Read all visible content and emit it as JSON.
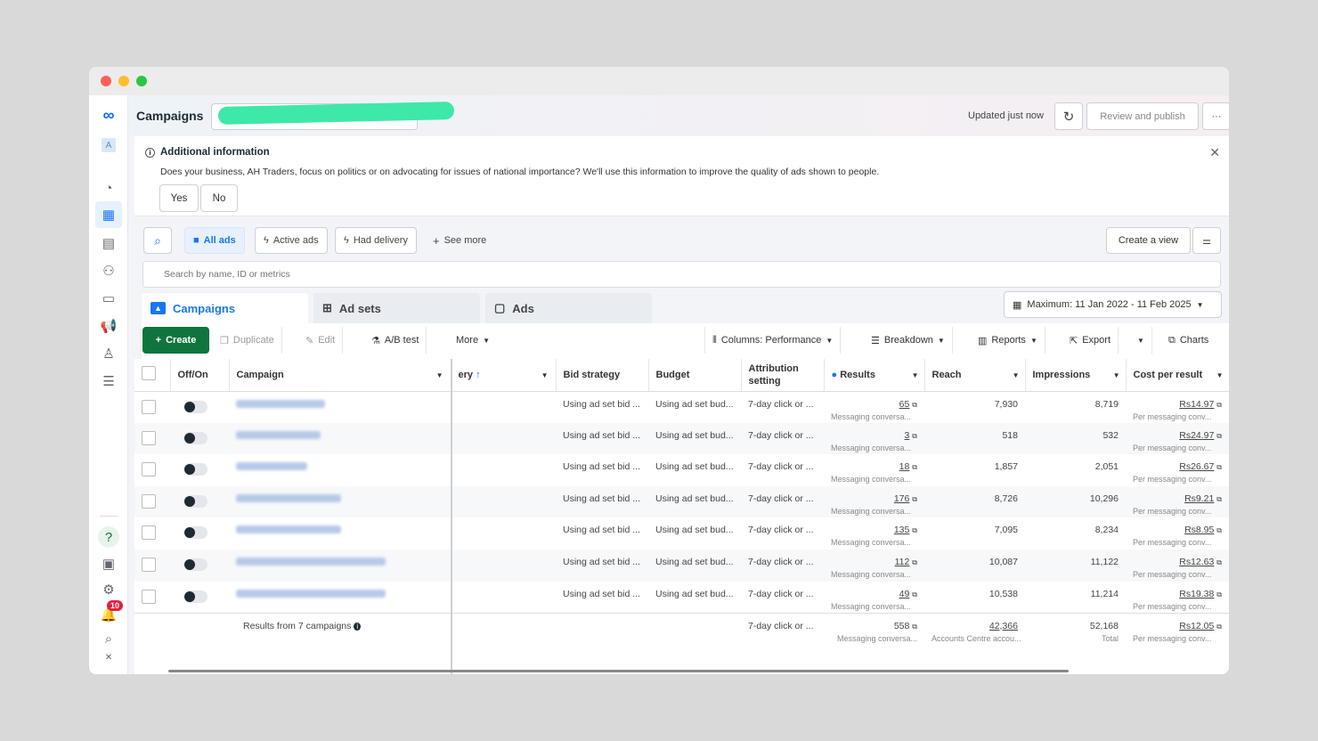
{
  "window": {
    "title": ""
  },
  "topbar": {
    "title": "Campaigns",
    "updated": "Updated just now",
    "review_publish": "Review and publish",
    "more": "···"
  },
  "notice": {
    "heading": "Additional information",
    "text": "Does your business, AH Traders, focus on politics or on advocating for issues of national importance? We'll use this information to improve the quality of ads shown to people.",
    "yes": "Yes",
    "no": "No"
  },
  "filters": {
    "all_ads": "All ads",
    "active_ads": "Active ads",
    "had_delivery": "Had delivery",
    "see_more": "See more",
    "create_view": "Create a view"
  },
  "search": {
    "placeholder": "Search by name, ID or metrics"
  },
  "tabs": {
    "campaigns": "Campaigns",
    "ad_sets": "Ad sets",
    "ads": "Ads"
  },
  "date_range": "Maximum: 11 Jan 2022 - 11 Feb 2025",
  "toolbar": {
    "create": "Create",
    "duplicate": "Duplicate",
    "edit": "Edit",
    "ab_test": "A/B test",
    "more": "More",
    "columns": "Columns: Performance",
    "breakdown": "Breakdown",
    "reports": "Reports",
    "export": "Export",
    "charts": "Charts"
  },
  "columns": {
    "off_on": "Off/On",
    "campaign": "Campaign",
    "delivery": "ery",
    "bid_strategy": "Bid strategy",
    "budget": "Budget",
    "attribution": "Attribution setting",
    "results": "Results",
    "reach": "Reach",
    "impressions": "Impressions",
    "cost_per_result": "Cost per result"
  },
  "rows": [
    {
      "bid": "Using ad set bid ...",
      "budget": "Using ad set bud...",
      "attr": "7-day click or ...",
      "results": "65",
      "results_sub": "Messaging conversa...",
      "reach": "7,930",
      "impr": "8,719",
      "cpr": "Rs14.97",
      "cpr_sub": "Per messaging conv..."
    },
    {
      "bid": "Using ad set bid ...",
      "budget": "Using ad set bud...",
      "attr": "7-day click or ...",
      "results": "3",
      "results_sub": "Messaging conversa...",
      "reach": "518",
      "impr": "532",
      "cpr": "Rs24.97",
      "cpr_sub": "Per messaging conv..."
    },
    {
      "bid": "Using ad set bid ...",
      "budget": "Using ad set bud...",
      "attr": "7-day click or ...",
      "results": "18",
      "results_sub": "Messaging conversa...",
      "reach": "1,857",
      "impr": "2,051",
      "cpr": "Rs26.67",
      "cpr_sub": "Per messaging conv..."
    },
    {
      "bid": "Using ad set bid ...",
      "budget": "Using ad set bud...",
      "attr": "7-day click or ...",
      "results": "176",
      "results_sub": "Messaging conversa...",
      "reach": "8,726",
      "impr": "10,296",
      "cpr": "Rs9.21",
      "cpr_sub": "Per messaging conv..."
    },
    {
      "bid": "Using ad set bid ...",
      "budget": "Using ad set bud...",
      "attr": "7-day click or ...",
      "results": "135",
      "results_sub": "Messaging conversa...",
      "reach": "7,095",
      "impr": "8,234",
      "cpr": "Rs8.95",
      "cpr_sub": "Per messaging conv..."
    },
    {
      "bid": "Using ad set bid ...",
      "budget": "Using ad set bud...",
      "attr": "7-day click or ...",
      "results": "112",
      "results_sub": "Messaging conversa...",
      "reach": "10,087",
      "impr": "11,122",
      "cpr": "Rs12.63",
      "cpr_sub": "Per messaging conv..."
    },
    {
      "bid": "Using ad set bid ...",
      "budget": "Using ad set bud...",
      "attr": "7-day click or ...",
      "results": "49",
      "results_sub": "Messaging conversa...",
      "reach": "10,538",
      "impr": "11,214",
      "cpr": "Rs19.38",
      "cpr_sub": "Per messaging conv..."
    }
  ],
  "footer": {
    "label": "Results from 7 campaigns",
    "attr": "7-day click or ...",
    "results": "558",
    "results_sub": "Messaging conversa...",
    "reach": "42,366",
    "reach_sub": "Accounts Centre accou...",
    "impr": "52,168",
    "impr_sub": "Total",
    "cpr": "Rs12.05",
    "cpr_sub": "Per messaging conv..."
  },
  "rail": {
    "account_letter": "A",
    "notifications": "10"
  },
  "colors": {
    "accent": "#1877f2",
    "create": "#10743d",
    "badge": "#e41e3f",
    "redaction": "#3ee8a8"
  }
}
